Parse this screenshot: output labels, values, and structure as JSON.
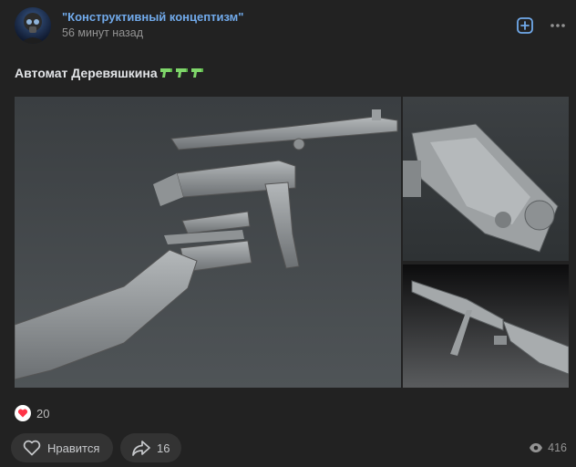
{
  "post": {
    "author": "\"Конструктивный концептизм\"",
    "time": "56 минут назад",
    "text": "Автомат Деревяшкина"
  },
  "icons": {
    "add_to_bookmarks": "plus-square-icon",
    "more": "more-horizontal-icon",
    "pistol_emoji": "pistol-icon",
    "heart": "heart-icon",
    "share": "share-arrow-icon",
    "views": "eye-icon"
  },
  "photos": [
    {
      "alt": "exploded-rifle-render"
    },
    {
      "alt": "rifle-receiver-closeup"
    },
    {
      "alt": "assembled-rifle-render"
    }
  ],
  "reactions": {
    "count": "20"
  },
  "actions": {
    "like_label": "Нравится",
    "share_count": "16"
  },
  "stats": {
    "views": "416"
  },
  "colors": {
    "background": "#222222",
    "author_link": "#71aaeb",
    "accent": "#71aaeb",
    "heart": "#ff3347",
    "pill_bg": "#333333",
    "pistol_green": "#7fd66a"
  }
}
